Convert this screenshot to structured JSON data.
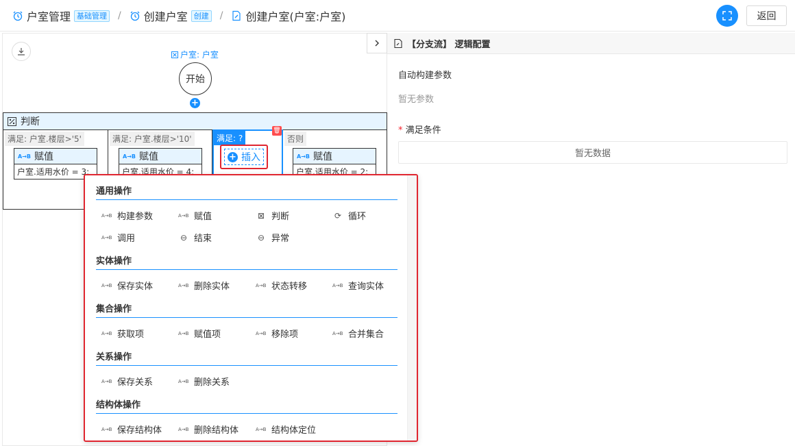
{
  "breadcrumb": {
    "items": [
      {
        "label": "户室管理",
        "tag": "基础管理"
      },
      {
        "label": "创建户室",
        "tag": "创建"
      },
      {
        "label": "创建户室(户室:户室)"
      }
    ],
    "separator": "/"
  },
  "toolbar": {
    "back_label": "返回"
  },
  "canvas": {
    "entity_label": "户室: 户室",
    "start_label": "开始",
    "judge_label": "判断",
    "branches": [
      {
        "condition": "满足: 户室.楼层>'5'",
        "assign_title": "赋值",
        "assign_body": "户室.适用水价 = 3;"
      },
      {
        "condition": "满足: 户室.楼层>'10'",
        "assign_title": "赋值",
        "assign_body": "户室.适用水价 = 4;"
      },
      {
        "condition": "满足: ?",
        "insert_label": "插入"
      },
      {
        "condition": "否则",
        "assign_title": "赋值",
        "assign_body": "户室.适用水价 = 2;"
      }
    ]
  },
  "menu": {
    "sections": [
      {
        "title": "通用操作",
        "items": [
          {
            "label": "构建参数",
            "icon": "a-to-b-icon"
          },
          {
            "label": "赋值",
            "icon": "a-to-b-icon"
          },
          {
            "label": "判断",
            "icon": "judge-icon"
          },
          {
            "label": "循环",
            "icon": "loop-icon"
          },
          {
            "label": "调用",
            "icon": "a-to-b-icon"
          },
          {
            "label": "结束",
            "icon": "end-icon"
          },
          {
            "label": "异常",
            "icon": "end-icon"
          }
        ]
      },
      {
        "title": "实体操作",
        "items": [
          {
            "label": "保存实体",
            "icon": "a-to-b-icon"
          },
          {
            "label": "删除实体",
            "icon": "a-to-b-icon"
          },
          {
            "label": "状态转移",
            "icon": "a-to-b-icon"
          },
          {
            "label": "查询实体",
            "icon": "a-to-b-icon"
          }
        ]
      },
      {
        "title": "集合操作",
        "items": [
          {
            "label": "获取项",
            "icon": "a-to-b-icon"
          },
          {
            "label": "赋值项",
            "icon": "a-to-b-icon"
          },
          {
            "label": "移除项",
            "icon": "a-to-b-icon"
          },
          {
            "label": "合并集合",
            "icon": "a-to-b-icon"
          }
        ]
      },
      {
        "title": "关系操作",
        "items": [
          {
            "label": "保存关系",
            "icon": "a-to-b-icon"
          },
          {
            "label": "删除关系",
            "icon": "a-to-b-icon"
          }
        ]
      },
      {
        "title": "结构体操作",
        "items": [
          {
            "label": "保存结构体",
            "icon": "a-to-b-icon"
          },
          {
            "label": "删除结构体",
            "icon": "a-to-b-icon"
          },
          {
            "label": "结构体定位",
            "icon": "a-to-b-icon"
          }
        ]
      }
    ],
    "ab_glyph": "A→B"
  },
  "right_panel": {
    "title": "【分支流】 逻辑配置",
    "auto_params_label": "自动构建参数",
    "no_params": "暂无参数",
    "required_mark": "*",
    "condition_label": "满足条件",
    "no_data": "暂无数据"
  },
  "colors": {
    "accent": "#1890ff",
    "highlight": "#e0252f"
  }
}
